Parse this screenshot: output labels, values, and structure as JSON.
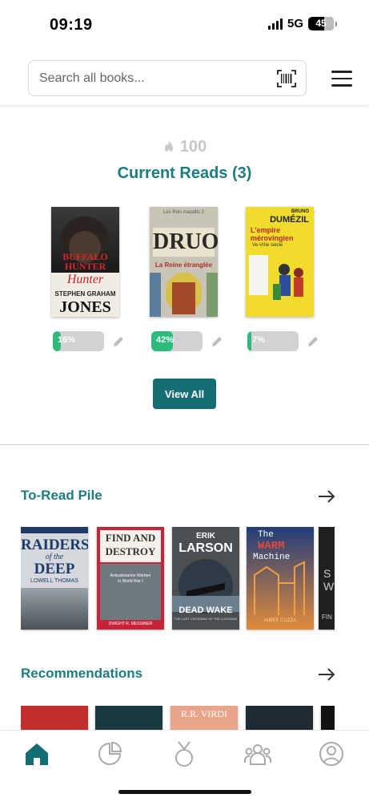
{
  "status": {
    "time": "09:19",
    "network": "5G",
    "battery": "45"
  },
  "search": {
    "placeholder": "Search all books...",
    "value": ""
  },
  "streak": {
    "count": "100"
  },
  "current_reads": {
    "title": "Current Reads (3)",
    "books": [
      {
        "cover_lines": [
          "BUFFALO",
          "HUNTER",
          "Hunter",
          "STEPHEN GRAHAM",
          "JONES"
        ],
        "progress_label": "16%",
        "progress": 0.16
      },
      {
        "cover_lines": [
          "Les Rois maudits 2",
          "DRUON",
          "La Reine étranglée"
        ],
        "progress_label": "42%",
        "progress": 0.42
      },
      {
        "cover_lines": [
          "BRUNO",
          "DUMÉZIL",
          "L'empire",
          "mérovingien",
          "Ve-VIIIe siècle"
        ],
        "progress_label": "7%",
        "progress": 0.07
      }
    ],
    "view_all_label": "View All"
  },
  "to_read": {
    "title": "To-Read Pile",
    "books": [
      {
        "cover_lines": [
          "RAIDERS",
          "of the",
          "DEEP",
          "LOWELL THOMAS"
        ]
      },
      {
        "cover_lines": [
          "FIND AND",
          "DESTROY",
          "Antisubmarine Warfare",
          "in World War I",
          "DWIGHT R. MESSIMER"
        ]
      },
      {
        "cover_lines": [
          "ERIK",
          "LARSON",
          "DEAD WAKE",
          "THE LAST CROSSING OF THE LUSITANIA"
        ]
      },
      {
        "cover_lines": [
          "The",
          "WARM",
          "Machine",
          "AIMEE CUZZA"
        ]
      },
      {
        "cover_lines": [
          "S",
          "W",
          "FIN"
        ]
      }
    ]
  },
  "recommendations": {
    "title": "Recommendations",
    "books": [
      {
        "cover_lines": [
          ""
        ]
      },
      {
        "cover_lines": [
          ""
        ]
      },
      {
        "cover_lines": [
          "R.R. VIRDI"
        ]
      },
      {
        "cover_lines": [
          ""
        ]
      },
      {
        "cover_lines": [
          ""
        ]
      }
    ]
  },
  "colors": {
    "accent": "#1b7d82",
    "button": "#136d73",
    "progress": "#2cbb7a"
  },
  "nav": [
    "home-icon",
    "stats-icon",
    "challenges-icon",
    "community-icon",
    "profile-icon"
  ]
}
